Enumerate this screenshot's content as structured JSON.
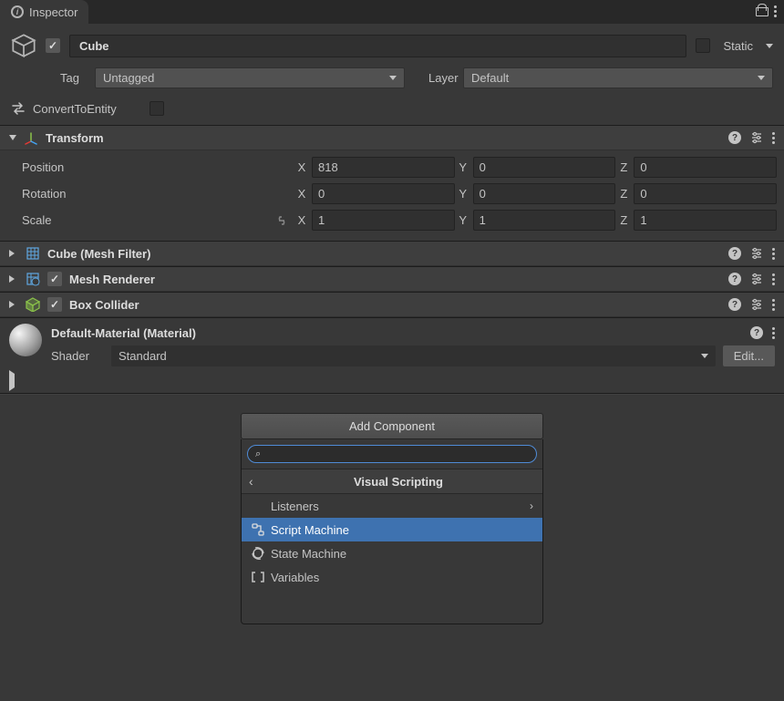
{
  "tab": {
    "title": "Inspector"
  },
  "header": {
    "object_enabled": true,
    "object_name": "Cube",
    "static_label": "Static",
    "static_checked": false
  },
  "tagLayer": {
    "tag_label": "Tag",
    "tag_value": "Untagged",
    "layer_label": "Layer",
    "layer_value": "Default"
  },
  "convert": {
    "label": "ConvertToEntity",
    "checked": false
  },
  "transform": {
    "title": "Transform",
    "position_label": "Position",
    "rotation_label": "Rotation",
    "scale_label": "Scale",
    "position": {
      "x": "818",
      "y": "0",
      "z": "0"
    },
    "rotation": {
      "x": "0",
      "y": "0",
      "z": "0"
    },
    "scale": {
      "x": "1",
      "y": "1",
      "z": "1"
    }
  },
  "meshFilter": {
    "title": "Cube (Mesh Filter)"
  },
  "meshRenderer": {
    "title": "Mesh Renderer",
    "enabled": true
  },
  "boxCollider": {
    "title": "Box Collider",
    "enabled": true
  },
  "material": {
    "title": "Default-Material (Material)",
    "shader_label": "Shader",
    "shader_value": "Standard",
    "edit_label": "Edit..."
  },
  "footer": {
    "add_component_label": "Add Component",
    "popup_search_placeholder": "",
    "popup_title": "Visual Scripting",
    "items": [
      {
        "label": "Listeners",
        "has_children": true,
        "selected": false,
        "icon": "none"
      },
      {
        "label": "Script Machine",
        "has_children": false,
        "selected": true,
        "icon": "graph"
      },
      {
        "label": "State Machine",
        "has_children": false,
        "selected": false,
        "icon": "state"
      },
      {
        "label": "Variables",
        "has_children": false,
        "selected": false,
        "icon": "var"
      }
    ]
  }
}
